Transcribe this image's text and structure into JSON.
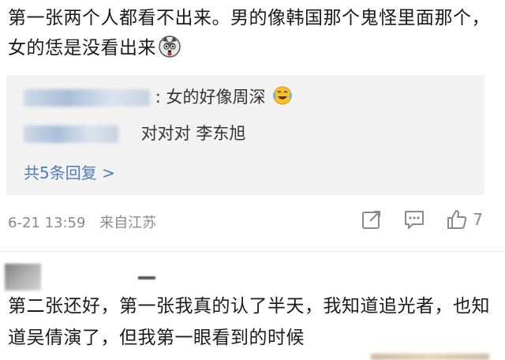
{
  "comment1": {
    "text": "第一张两个人都看不出来。男的像韩国那个鬼怪里面那个，女的恁是没看出来",
    "emoji": "husky-emoji"
  },
  "replies": [
    {
      "text": ": 女的好像周深",
      "emoji": "laugh-cry-emoji"
    },
    {
      "text": "对对对 李东旭"
    }
  ],
  "more_replies": "共5条回复 >",
  "meta": {
    "time": "6-21 13:59",
    "source": "来自江苏"
  },
  "actions": {
    "share_icon": "share-icon",
    "comment_icon": "comment-icon",
    "like_icon": "thumbs-up-icon",
    "like_count": "7"
  },
  "comment2": {
    "text": "第二张还好，第一张我真的认了半天，我知道追光者，也知道吴倩演了，但我第一眼看到的时候"
  }
}
